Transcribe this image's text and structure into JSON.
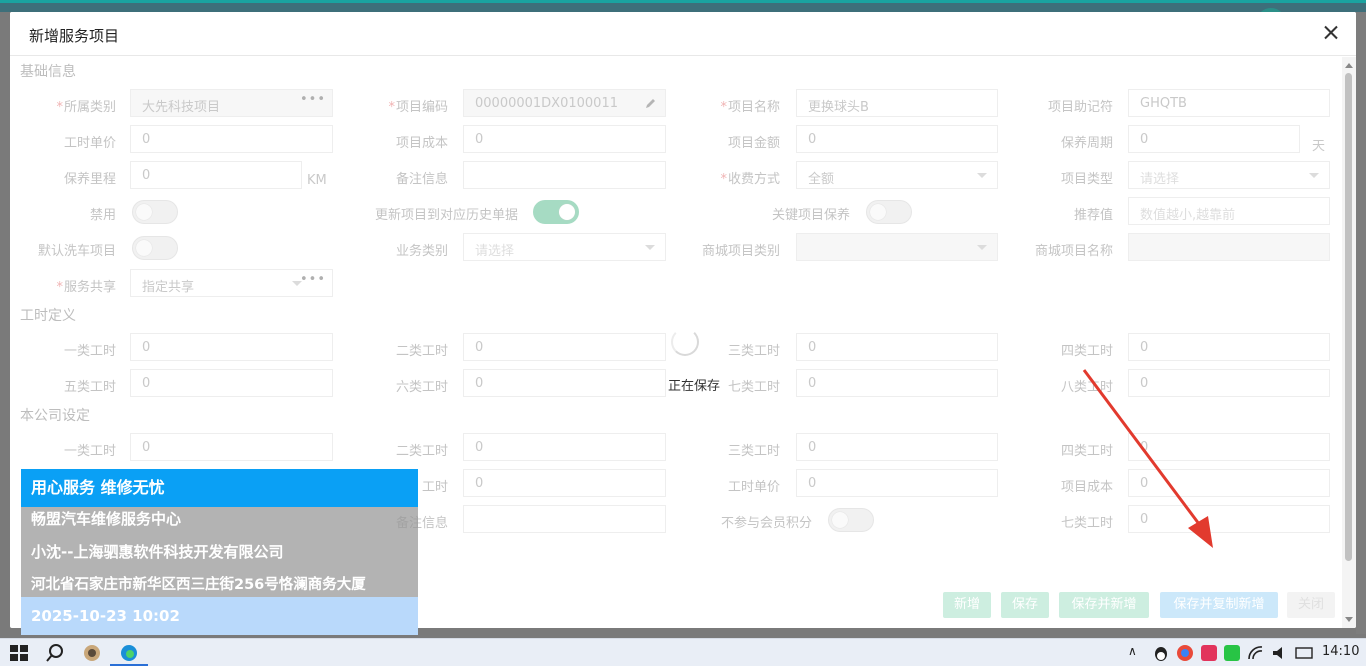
{
  "dialog": {
    "title": "新增服务项目"
  },
  "sections": {
    "basic": "基础信息",
    "labor_def": "工时定义",
    "company": "本公司设定"
  },
  "basic": {
    "category": {
      "label": "所属类别",
      "value": "大先科技项目"
    },
    "code": {
      "label": "项目编码",
      "value": "00000001DX0100011"
    },
    "name": {
      "label": "项目名称",
      "value": "更换球头B"
    },
    "mnemonic": {
      "label": "项目助记符",
      "value": "GHQTB"
    },
    "labor_price": {
      "label": "工时单价",
      "value": "0"
    },
    "cost": {
      "label": "项目成本",
      "value": "0"
    },
    "amount": {
      "label": "项目金额",
      "value": "0"
    },
    "maint_period": {
      "label": "保养周期",
      "value": "0",
      "unit": "天"
    },
    "maint_mileage": {
      "label": "保养里程",
      "value": "0",
      "unit": "KM"
    },
    "remark": {
      "label": "备注信息",
      "value": ""
    },
    "charge_mode": {
      "label": "收费方式",
      "value": "全额"
    },
    "item_type": {
      "label": "项目类型",
      "placeholder": "请选择"
    },
    "disabled": {
      "label": "禁用"
    },
    "update_history": {
      "label": "更新项目到对应历史单据"
    },
    "key_maint": {
      "label": "关键项目保养"
    },
    "recommend": {
      "label": "推荐值",
      "placeholder": "数值越小,越靠前"
    },
    "default_wash": {
      "label": "默认洗车项目"
    },
    "biz_category": {
      "label": "业务类别",
      "placeholder": "请选择"
    },
    "mall_category": {
      "label": "商城项目类别",
      "value": ""
    },
    "mall_name": {
      "label": "商城项目名称",
      "value": ""
    },
    "share": {
      "label": "服务共享",
      "value": "指定共享"
    }
  },
  "labor": {
    "l1": {
      "label": "一类工时",
      "value": "0"
    },
    "l2": {
      "label": "二类工时",
      "value": "0"
    },
    "l3": {
      "label": "三类工时",
      "value": "0"
    },
    "l4": {
      "label": "四类工时",
      "value": "0"
    },
    "l5": {
      "label": "五类工时",
      "value": "0"
    },
    "l6": {
      "label": "六类工时",
      "value": "0"
    },
    "l7": {
      "label": "七类工时",
      "value": "0"
    },
    "l8": {
      "label": "八类工时",
      "value": "0"
    }
  },
  "company": {
    "l1": {
      "label": "一类工时",
      "value": "0"
    },
    "l2": {
      "label": "二类工时",
      "value": "0"
    },
    "l3": {
      "label": "三类工时",
      "value": "0"
    },
    "l4": {
      "label": "四类工时",
      "value": "0"
    },
    "l6": {
      "label": "工时",
      "value": "0"
    },
    "labor_price": {
      "label": "工时单价",
      "value": "0"
    },
    "cost": {
      "label": "项目成本",
      "value": "0"
    },
    "remark": {
      "label": "备注信息",
      "value": ""
    },
    "no_points": {
      "label": "不参与会员积分"
    },
    "l7": {
      "label": "七类工时",
      "value": "0"
    }
  },
  "loading": {
    "text": "正在保存"
  },
  "footer": {
    "add": "新增",
    "save": "保存",
    "save_add": "保存并新增",
    "save_copy_add": "保存并复制新增",
    "close": "关闭"
  },
  "watermark": {
    "line1": "用心服务 维修无忧",
    "line2": "畅盟汽车维修服务中心",
    "line3": "小沈--上海驷惠软件科技开发有限公司",
    "line4": "河北省石家庄市新华区西三庄街256号恪澜商务大厦",
    "line5": "2025-10-23 10:02"
  },
  "taskbar": {
    "time": "14:10"
  },
  "colors": {
    "watermark_header": "#0aa0f5",
    "watermark_gray": "#bdbdbd",
    "watermark_footer": "#b9d9fb",
    "btn_green": "#cdeee0",
    "btn_blue": "#cce8fa",
    "arrow": "#e23a2e"
  }
}
